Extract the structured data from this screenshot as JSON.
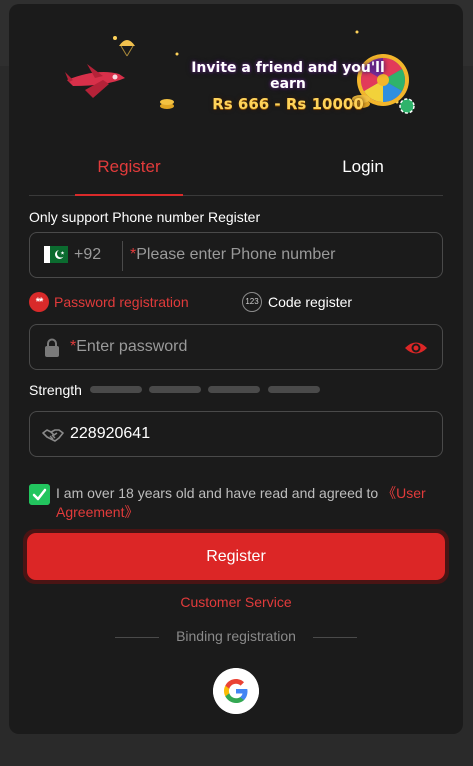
{
  "banner": {
    "line1": "Invite a friend and you'll earn",
    "line2": "Rs 666 - Rs 10000"
  },
  "tabs": [
    {
      "label": "Register",
      "active": true
    },
    {
      "label": "Login",
      "active": false
    }
  ],
  "form": {
    "section_title": "Only support Phone number Register",
    "phone": {
      "country_code": "+92",
      "required_mark": "*",
      "placeholder": "Please enter Phone number",
      "flag_icon": "pakistan-flag-icon"
    },
    "modes": {
      "password": {
        "icon_text": "**",
        "label": "Password registration",
        "selected": true
      },
      "code": {
        "icon_text": "123",
        "label": "Code register",
        "selected": false
      }
    },
    "password": {
      "required_mark": "*",
      "placeholder": "Enter password",
      "lock_icon": "lock-icon",
      "eye_icon": "eye-icon"
    },
    "strength": {
      "label": "Strength",
      "bars": 4,
      "filled": 0
    },
    "invite_code": {
      "value": "228920641",
      "icon": "handshake-icon"
    },
    "agreement": {
      "checked": true,
      "text": "I am over 18 years old and have read and agreed to ",
      "link_text": "《User Agreement》"
    },
    "register_button": "Register",
    "customer_service": "Customer Service",
    "binding_label": "Binding registration",
    "google_icon": "google-icon"
  },
  "colors": {
    "accent": "#dc2626",
    "accent_text": "#e13b3b",
    "background": "#1b1b1b",
    "check": "#22c55e",
    "banner_gold": "#ffd35a"
  }
}
